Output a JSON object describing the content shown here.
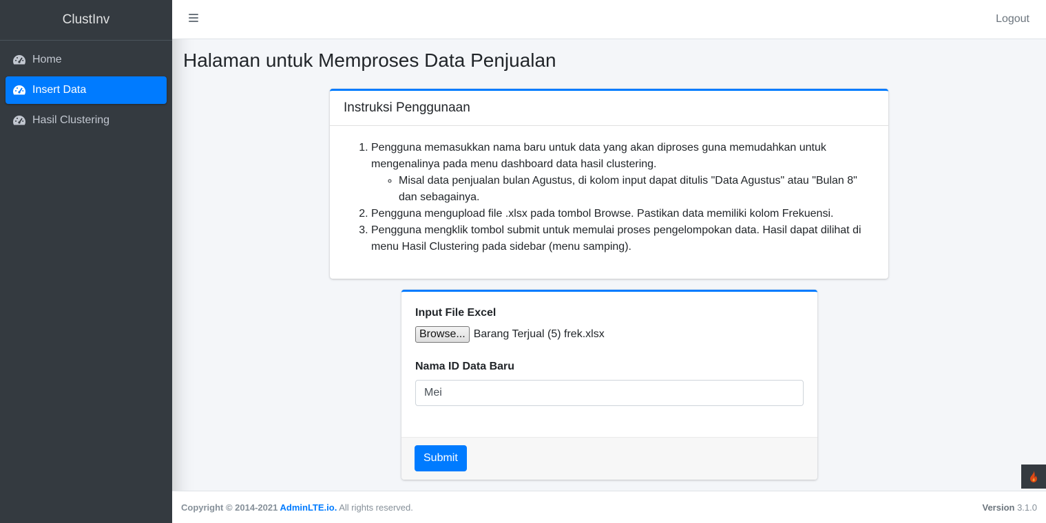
{
  "sidebar": {
    "brand": "ClustInv",
    "items": [
      {
        "label": "Home",
        "icon": "tachometer-icon",
        "active": false
      },
      {
        "label": "Insert Data",
        "icon": "tachometer-icon",
        "active": true
      },
      {
        "label": "Hasil Clustering",
        "icon": "tachometer-icon",
        "active": false
      }
    ]
  },
  "topbar": {
    "logout_label": "Logout"
  },
  "page": {
    "title": "Halaman untuk Memproses Data Penjualan"
  },
  "instructions": {
    "header": "Instruksi Penggunaan",
    "step1": "Pengguna memasukkan nama baru untuk data yang akan diproses guna memudahkan untuk mengenalinya pada menu dashboard data hasil clustering.",
    "step1_sub": "Misal data penjualan bulan Agustus, di kolom input dapat ditulis \"Data Agustus\" atau \"Bulan 8\" dan sebagainya.",
    "step2": "Pengguna mengupload file .xlsx pada tombol Browse. Pastikan data memiliki kolom Frekuensi.",
    "step3": "Pengguna mengklik tombol submit untuk memulai proses pengelompokan data. Hasil dapat dilihat di menu Hasil Clustering pada sidebar (menu samping)."
  },
  "form": {
    "file_label": "Input File Excel",
    "browse_label": "Browse...",
    "file_name": "Barang Terjual (5) frek.xlsx",
    "name_label": "Nama ID Data Baru",
    "name_value": "Mei",
    "submit_label": "Submit"
  },
  "footer": {
    "copyright": "Copyright © 2014-2021",
    "link": "AdminLTE.io.",
    "rights": "All rights reserved.",
    "version_label": "Version",
    "version": "3.1.0"
  },
  "colors": {
    "primary": "#007bff",
    "sidebar": "#343a40",
    "background": "#f4f6f9"
  }
}
